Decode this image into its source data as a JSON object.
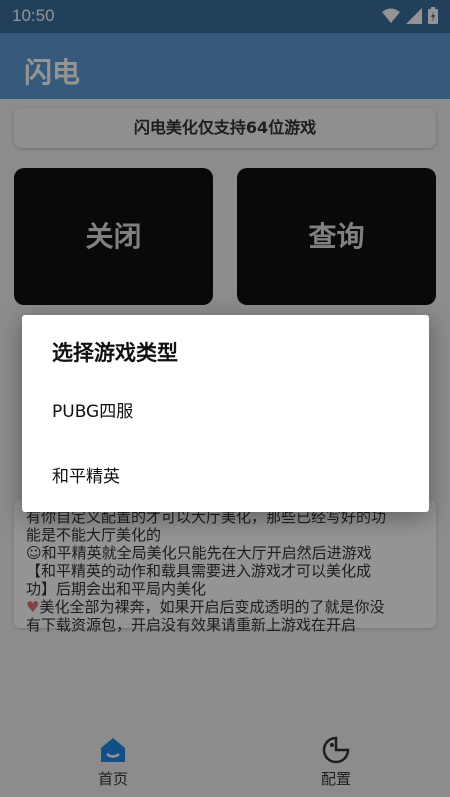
{
  "status": {
    "time": "10:50"
  },
  "appbar": {
    "title": "闪电"
  },
  "notice": "闪电美化仅支持64位游戏",
  "buttons": {
    "close": "关闭",
    "query": "查询"
  },
  "info": {
    "lines": [
      "有你自定义配置的才可以大厅美化，那些已经写好的功",
      "能是不能大厅美化的",
      "和平精英就全局美化只能先在大厅开启然后进游戏",
      "【和平精英的动作和载具需要进入游戏才可以美化成",
      "功】后期会出和平局内美化",
      "美化全部为裸奔，如果开启后变成透明的了就是你没",
      "有下载资源包，开启没有效果请重新上游戏在开启"
    ]
  },
  "nav": {
    "home": "首页",
    "config": "配置"
  },
  "dialog": {
    "title": "选择游戏类型",
    "options": [
      "PUBG四服",
      "和平精英"
    ]
  },
  "colors": {
    "statusbar": "#3b6e9e",
    "appbar": "#5c9bd5",
    "accent": "#1e88e5"
  }
}
